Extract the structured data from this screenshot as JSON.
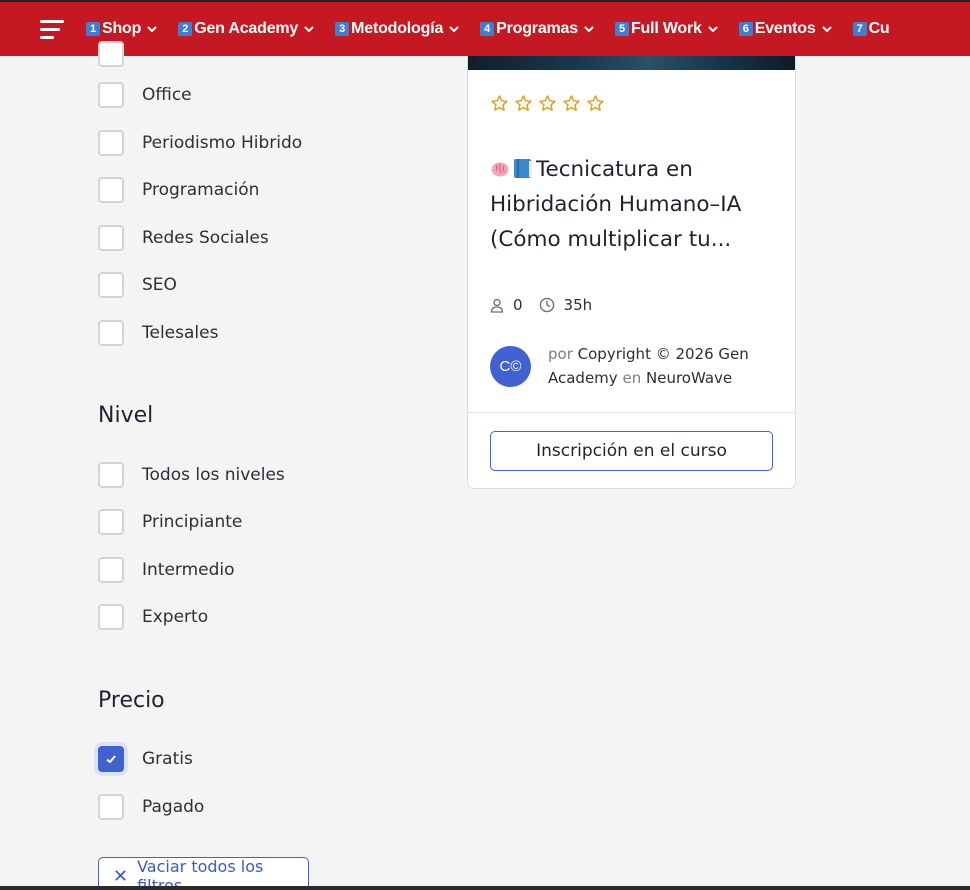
{
  "nav": {
    "items": [
      {
        "num": "1",
        "label": "Shop"
      },
      {
        "num": "2",
        "label": "Gen Academy"
      },
      {
        "num": "3",
        "label": "Metodología"
      },
      {
        "num": "4",
        "label": "Programas"
      },
      {
        "num": "5",
        "label": "Full Work"
      },
      {
        "num": "6",
        "label": "Eventos"
      },
      {
        "num": "7",
        "label": "Cu"
      }
    ],
    "menu_icon": "hamburger-icon",
    "colors": {
      "background": "#c41822",
      "badge": "#3f7fcf"
    }
  },
  "filters": {
    "category_options": [
      "Office",
      "Periodismo Hibrido",
      "Programación",
      "Redes Sociales",
      "SEO",
      "Telesales"
    ],
    "level": {
      "title": "Nivel",
      "options": [
        "Todos los niveles",
        "Principiante",
        "Intermedio",
        "Experto"
      ]
    },
    "price": {
      "title": "Precio",
      "options": [
        {
          "label": "Gratis",
          "checked": true
        },
        {
          "label": "Pagado",
          "checked": false
        }
      ]
    },
    "clear_label": "Vaciar todos los filtros"
  },
  "course_card": {
    "rating_stars": 5,
    "rating_filled": 0,
    "title_text": "Tecnicatura en Hibridación Humano–IA (Cómo multiplicar tu...",
    "students": "0",
    "duration": "35h",
    "author": {
      "avatar_initials": "C©",
      "by_label": "por",
      "name": "Copyright © 2026 Gen Academy",
      "in_label": "en",
      "category": "NeuroWave"
    },
    "enroll_label": "Inscripción en el curso"
  },
  "colors": {
    "accent": "#4062d1",
    "star": "#d9a017"
  }
}
